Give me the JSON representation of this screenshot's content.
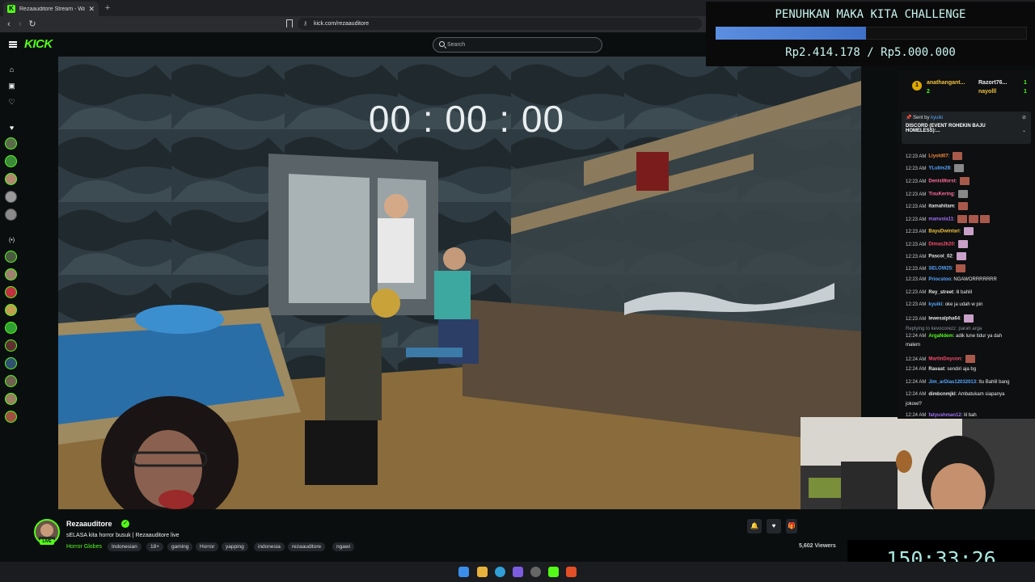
{
  "browser": {
    "tab_title": "Rezaauditore Stream - Watch",
    "url": "kick.com/rezaauditore"
  },
  "kick": {
    "logo": "KICK",
    "search_placeholder": "Search"
  },
  "overlay": {
    "challenge_title": "PENUHKAN MAKA KITA CHALLENGE",
    "progress": 0.483,
    "amount": "Rp2.414.178 / Rp5.000.000",
    "stream_timer": "00 : 00 : 00",
    "count_up": "150:33:26"
  },
  "stream": {
    "streamer": "Rezaauditore",
    "live_badge": "LIVE",
    "title": "sELASA kita horror busuk | Rezaauditore live",
    "category": "Horror Globes",
    "tags": [
      "Indonesian",
      "18+",
      "gaming",
      "Horror",
      "yapping",
      "indonesia",
      "rezaauditore",
      "ngawi"
    ],
    "viewers": "5,602 Viewers"
  },
  "chat": {
    "top_gifters": [
      {
        "name": "anathangant...",
        "count": "2"
      },
      {
        "name": "Razort76...",
        "count": "1"
      },
      {
        "name": "nayolll",
        "count": "1"
      }
    ],
    "pinned": {
      "sent_by": "Sent by",
      "user": "kyuiki",
      "text": "DISCORD (EVENT ROHEKIN BAJU HOMELESS):..."
    },
    "messages": [
      {
        "time": "12:23 AM",
        "user": "Llyold07",
        "color": "#f0883e",
        "text": "",
        "emotes": 1
      },
      {
        "time": "12:23 AM",
        "user": "YLubis28",
        "color": "#58a6ff",
        "text": "",
        "emotes": 1
      },
      {
        "time": "12:23 AM",
        "user": "DenisWorst",
        "color": "#ff6b9a",
        "text": "",
        "emotes": 1
      },
      {
        "time": "12:23 AM",
        "user": "TisuKering",
        "color": "#ff6b9a",
        "text": "",
        "emotes": 1
      },
      {
        "time": "12:23 AM",
        "user": "itamahitam",
        "color": "#e6e6e6",
        "text": "",
        "emotes": 1
      },
      {
        "time": "12:23 AM",
        "user": "manusia11",
        "color": "#a371f7",
        "text": "",
        "emotes": 3
      },
      {
        "time": "12:23 AM",
        "user": "BayuDwintari",
        "color": "#f0c040",
        "text": "",
        "emotes": 1
      },
      {
        "time": "12:23 AM",
        "user": "Dimas2k20",
        "color": "#ff4d6d",
        "text": "",
        "emotes": 1
      },
      {
        "time": "12:23 AM",
        "user": "Pascol_02",
        "color": "#e6e6e6",
        "text": "",
        "emotes": 1
      },
      {
        "time": "12:23 AM",
        "user": "SELOW25",
        "color": "#58a6ff",
        "text": "",
        "emotes": 1
      },
      {
        "time": "12:23 AM",
        "user": "Priocstoo",
        "color": "#58a6ff",
        "text": "NGAWORRRRRRR",
        "emotes": 0
      },
      {
        "time": "12:23 AM",
        "user": "Rey_street",
        "color": "#e6e6e6",
        "text": "lil bahlil",
        "emotes": 0
      },
      {
        "time": "12:23 AM",
        "user": "kyuiki",
        "color": "#58a6ff",
        "text": "oke ja udah w pin",
        "emotes": 0
      },
      {
        "time": "12:23 AM",
        "user": "lewesalpha64",
        "color": "#e6e6e6",
        "text": "",
        "emotes": 1
      },
      {
        "time": "",
        "user": "Replying to kevocorezz: parah arga",
        "color": "#8b949e",
        "text": "",
        "emotes": 0
      },
      {
        "time": "12:24 AM",
        "user": "ArgaNdem",
        "color": "#53fc18",
        "text": "adik lune tidur ya dah",
        "emotes": 0
      },
      {
        "time": "",
        "user": "",
        "color": "#eee",
        "text": "malem",
        "emotes": 0
      },
      {
        "time": "12:24 AM",
        "user": "MartinDoycon",
        "color": "#ff4d6d",
        "text": "",
        "emotes": 1
      },
      {
        "time": "12:24 AM",
        "user": "Ravast",
        "color": "#e6e6e6",
        "text": "sendiri aja bg",
        "emotes": 0
      },
      {
        "time": "12:24 AM",
        "user": "Jim_arDias12032013",
        "color": "#58a6ff",
        "text": "Itu Bahlil bang",
        "emotes": 0
      },
      {
        "time": "12:24 AM",
        "user": "dimbcnmjkl",
        "color": "#e6e6e6",
        "text": "Ambatukam siapanya",
        "emotes": 0
      },
      {
        "time": "",
        "user": "",
        "color": "#eee",
        "text": "jokowi?",
        "emotes": 0
      },
      {
        "time": "12:24 AM",
        "user": "fatyushman12",
        "color": "#a371f7",
        "text": "lil bah",
        "emotes": 0
      }
    ]
  },
  "colors": {
    "kick_green": "#53fc18",
    "overlay_text": "#c9f5ef",
    "progress_blue": "#5b8ee0"
  }
}
